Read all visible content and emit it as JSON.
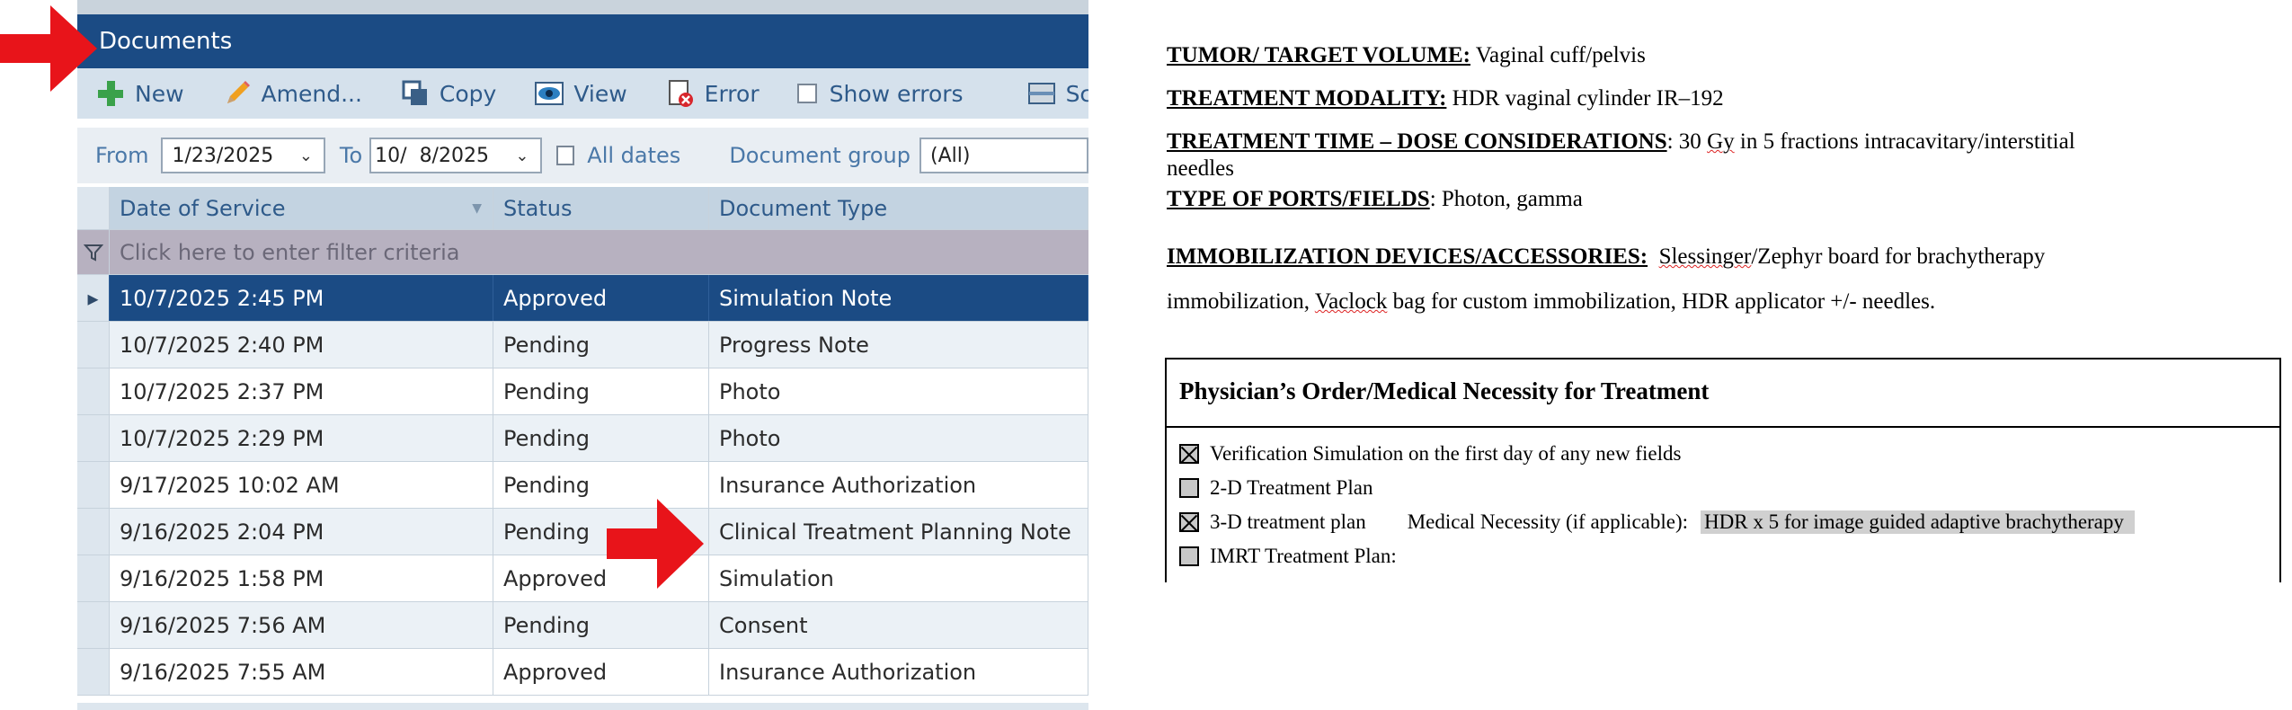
{
  "app": {
    "title": "Documents",
    "toolbar": {
      "new_label": "New",
      "amend_label": "Amend...",
      "copy_label": "Copy",
      "view_label": "View",
      "error_label": "Error",
      "show_errors_label": "Show errors",
      "scan_label": "Scan"
    },
    "filters": {
      "from_label": "From",
      "from_value": "1/23/2025",
      "to_label": "To",
      "to_value": "10/  8/2025",
      "all_dates_label": "All dates",
      "doc_group_label": "Document group",
      "doc_group_value": "(All)"
    },
    "grid": {
      "columns": [
        "Date of Service",
        "Status",
        "Document Type"
      ],
      "filter_placeholder": "Click here to enter filter criteria",
      "rows": [
        {
          "date": "10/7/2025 2:45 PM",
          "status": "Approved",
          "type": "Simulation Note",
          "selected": true
        },
        {
          "date": "10/7/2025 2:40 PM",
          "status": "Pending",
          "type": "Progress Note"
        },
        {
          "date": "10/7/2025 2:37 PM",
          "status": "Pending",
          "type": "Photo"
        },
        {
          "date": "10/7/2025 2:29 PM",
          "status": "Pending",
          "type": "Photo"
        },
        {
          "date": "9/17/2025 10:02 AM",
          "status": "Pending",
          "type": "Insurance Authorization"
        },
        {
          "date": "9/16/2025 2:04 PM",
          "status": "Pending",
          "type": "Clinical Treatment Planning Note"
        },
        {
          "date": "9/16/2025 1:58 PM",
          "status": "Approved",
          "type": "Simulation"
        },
        {
          "date": "9/16/2025 7:56 AM",
          "status": "Pending",
          "type": "Consent"
        },
        {
          "date": "9/16/2025 7:55 AM",
          "status": "Approved",
          "type": "Insurance Authorization"
        }
      ]
    },
    "colors": {
      "titlebar": "#1b4b84",
      "selected_row": "#1b4b84",
      "arrow": "#e8141a"
    }
  },
  "document": {
    "tumor_label": "TUMOR/ TARGET VOLUME:",
    "tumor_value": " Vaginal cuff/pelvis",
    "modality_label": "TREATMENT MODALITY:",
    "modality_value": " HDR vaginal cylinder IR–192",
    "time_label": "TREATMENT TIME – DOSE CONSIDERATIONS",
    "time_value_1": ": 30 ",
    "time_value_gy": "Gy",
    "time_value_2": " in 5 fractions intracavitary/interstitial",
    "time_value_3": "needles",
    "ports_label": "TYPE OF PORTS/FIELDS",
    "ports_value": ": Photon, gamma",
    "immob_label": "IMMOBILIZATION DEVICES/ACCESSORIES:",
    "immob_value_1a": "  ",
    "immob_value_1b": "Slessinger",
    "immob_value_1c": "/Zephyr board for brachytherapy",
    "immob_value_2a": "immobilization, ",
    "immob_value_2b": "Vaclock",
    "immob_value_2c": " bag for custom immobilization, HDR applicator +/- needles.",
    "order_title": "Physician’s Order/Medical Necessity for Treatment",
    "orders": [
      {
        "label": "Verification Simulation on the first day of any new fields",
        "checked": true
      },
      {
        "label": "2-D Treatment Plan",
        "checked": false
      },
      {
        "label": "3-D treatment plan",
        "checked": true
      },
      {
        "label": "IMRT Treatment Plan:",
        "checked": false
      }
    ],
    "necessity_label": "Medical Necessity (if applicable):",
    "necessity_value": "HDR x 5 for image guided adaptive brachytherapy"
  }
}
